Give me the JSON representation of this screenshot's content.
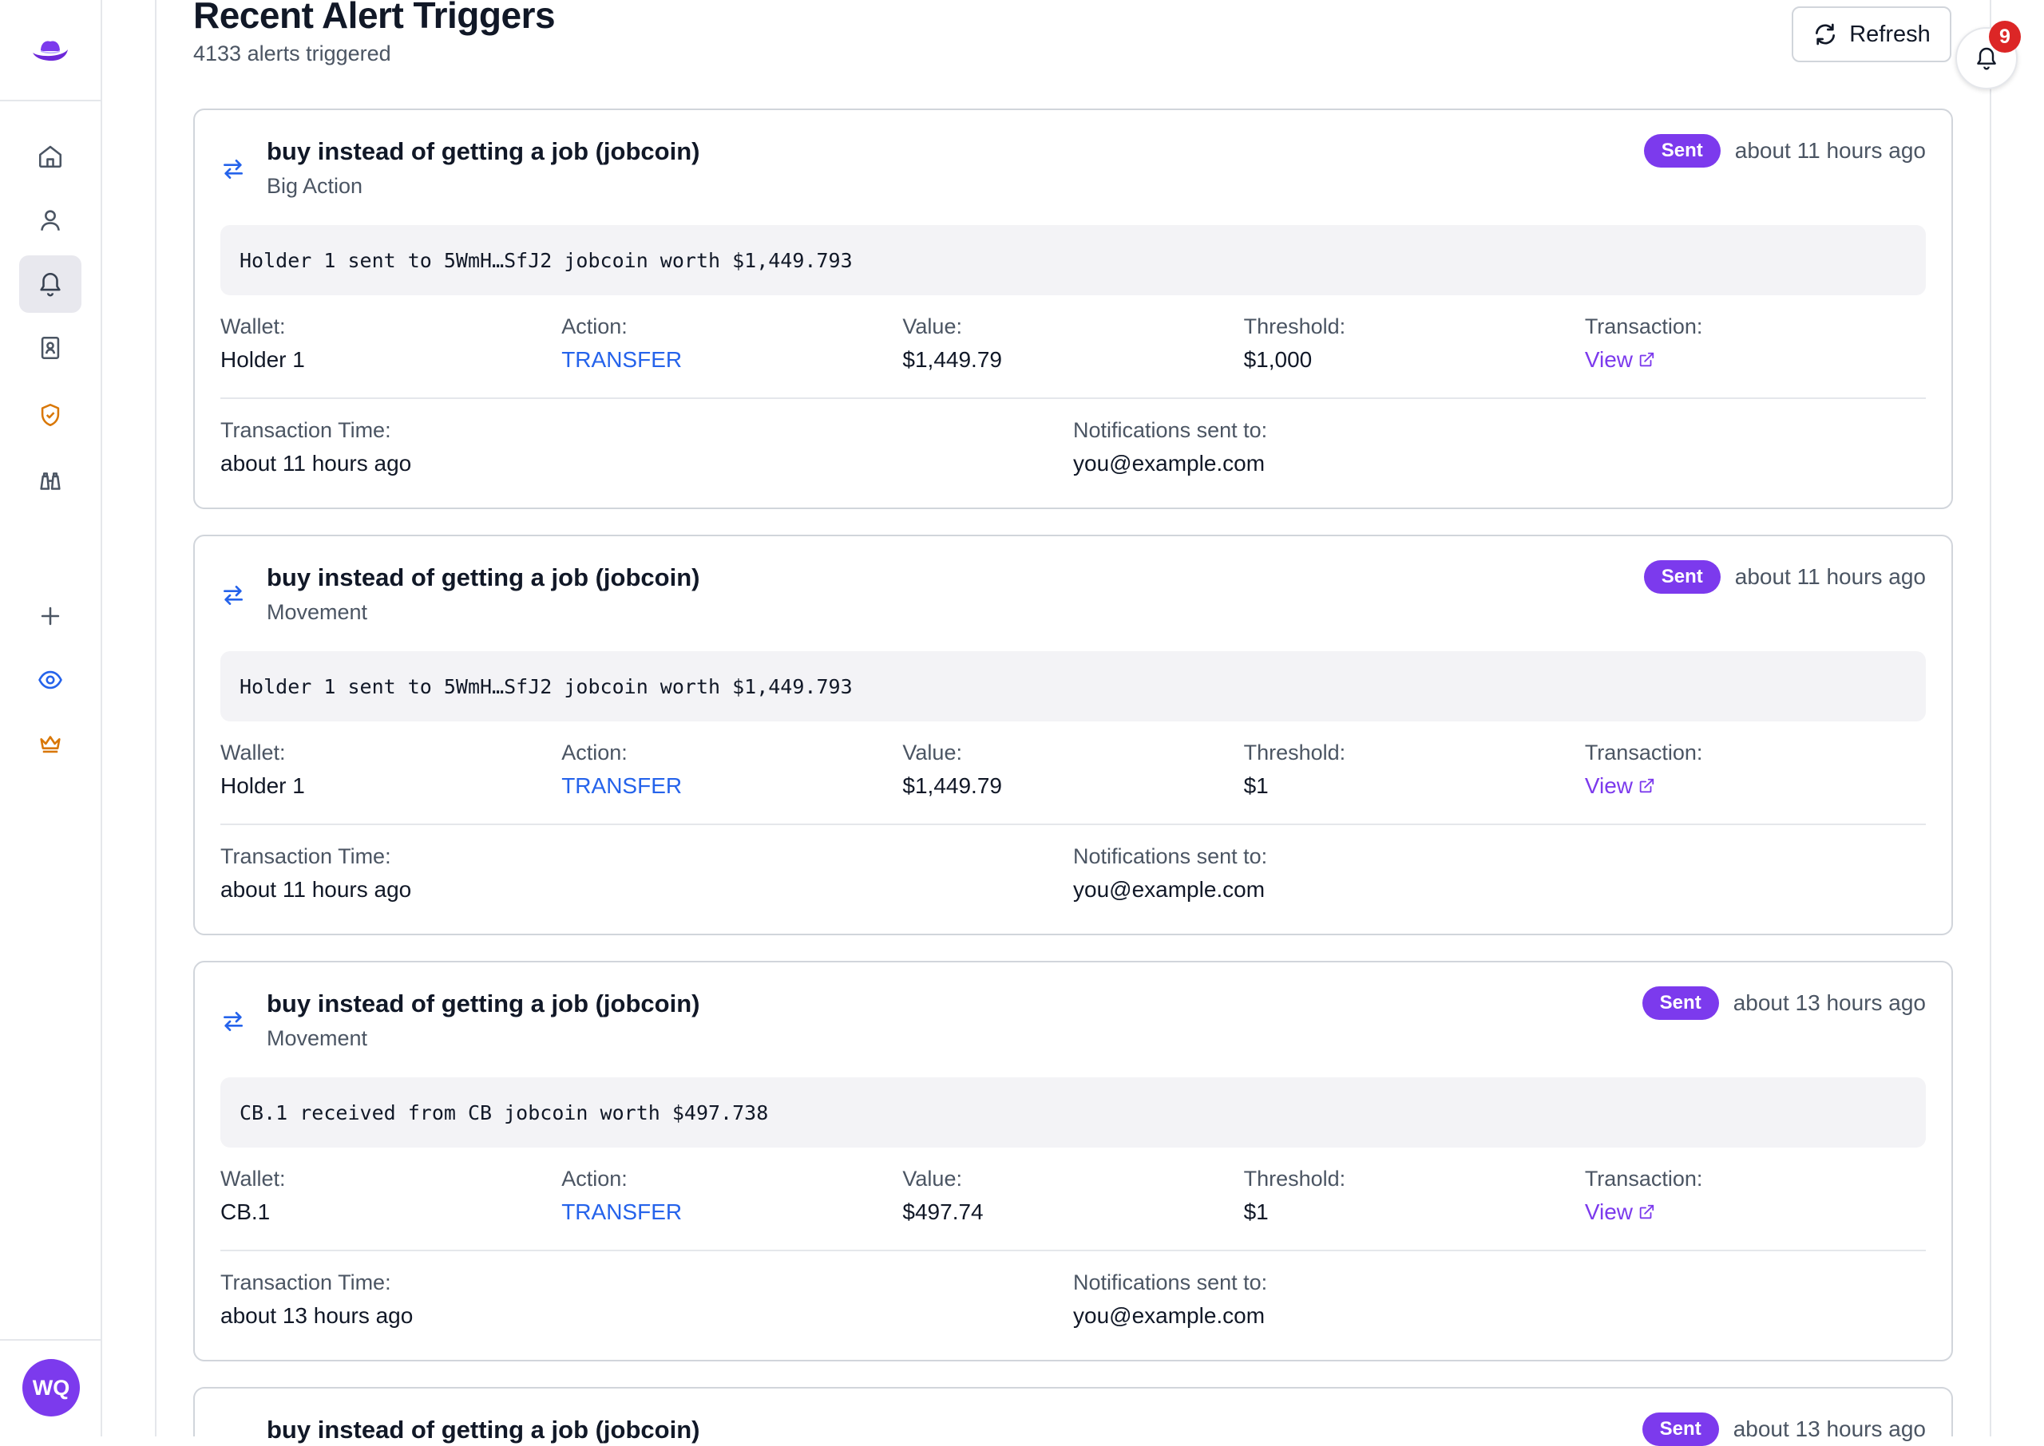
{
  "header": {
    "title": "Recent Alert Triggers",
    "subtitle": "4133 alerts triggered",
    "refresh_label": "Refresh",
    "notification_count": "9"
  },
  "sidebar": {
    "items": [
      {
        "name": "home",
        "icon": "home-icon",
        "active": false
      },
      {
        "name": "profile",
        "icon": "user-icon",
        "active": false
      },
      {
        "name": "alerts",
        "icon": "bell-icon",
        "active": true
      },
      {
        "name": "contacts",
        "icon": "contact-book-icon",
        "active": false
      },
      {
        "name": "security",
        "icon": "shield-check-icon",
        "active": false
      },
      {
        "name": "watch",
        "icon": "binoculars-icon",
        "active": false
      },
      {
        "name": "add",
        "icon": "plus-icon",
        "active": false
      },
      {
        "name": "watchlist",
        "icon": "eye-icon",
        "active": false
      },
      {
        "name": "premium",
        "icon": "crown-icon",
        "active": false
      }
    ],
    "user_initials": "WQ"
  },
  "labels": {
    "wallet": "Wallet:",
    "action": "Action:",
    "value": "Value:",
    "threshold": "Threshold:",
    "transaction": "Transaction:",
    "transaction_time": "Transaction Time:",
    "notifications_sent_to": "Notifications sent to:",
    "view": "View"
  },
  "alerts": [
    {
      "title": "buy instead of getting a job (jobcoin)",
      "type": "Big Action",
      "status": "Sent",
      "time_ago": "about 11 hours ago",
      "message": "Holder 1 sent to 5WmH…SfJ2 jobcoin worth $1,449.793",
      "wallet": "Holder 1",
      "action": "TRANSFER",
      "value": "$1,449.79",
      "threshold": "$1,000",
      "transaction_time": "about 11 hours ago",
      "notified": "you@example.com"
    },
    {
      "title": "buy instead of getting a job (jobcoin)",
      "type": "Movement",
      "status": "Sent",
      "time_ago": "about 11 hours ago",
      "message": "Holder 1 sent to 5WmH…SfJ2 jobcoin worth $1,449.793",
      "wallet": "Holder 1",
      "action": "TRANSFER",
      "value": "$1,449.79",
      "threshold": "$1",
      "transaction_time": "about 11 hours ago",
      "notified": "you@example.com"
    },
    {
      "title": "buy instead of getting a job (jobcoin)",
      "type": "Movement",
      "status": "Sent",
      "time_ago": "about 13 hours ago",
      "message": "CB.1 received from CB jobcoin worth $497.738",
      "wallet": "CB.1",
      "action": "TRANSFER",
      "value": "$497.74",
      "threshold": "$1",
      "transaction_time": "about 13 hours ago",
      "notified": "you@example.com"
    },
    {
      "title": "buy instead of getting a job (jobcoin)",
      "type": "",
      "status": "Sent",
      "time_ago": "about 13 hours ago",
      "message": "",
      "wallet": "",
      "action": "",
      "value": "",
      "threshold": "",
      "transaction_time": "",
      "notified": ""
    }
  ],
  "colors": {
    "accent": "#7c3aed",
    "action_blue": "#2563eb",
    "badge_red": "#dc2626",
    "warning_orange": "#d97706"
  }
}
